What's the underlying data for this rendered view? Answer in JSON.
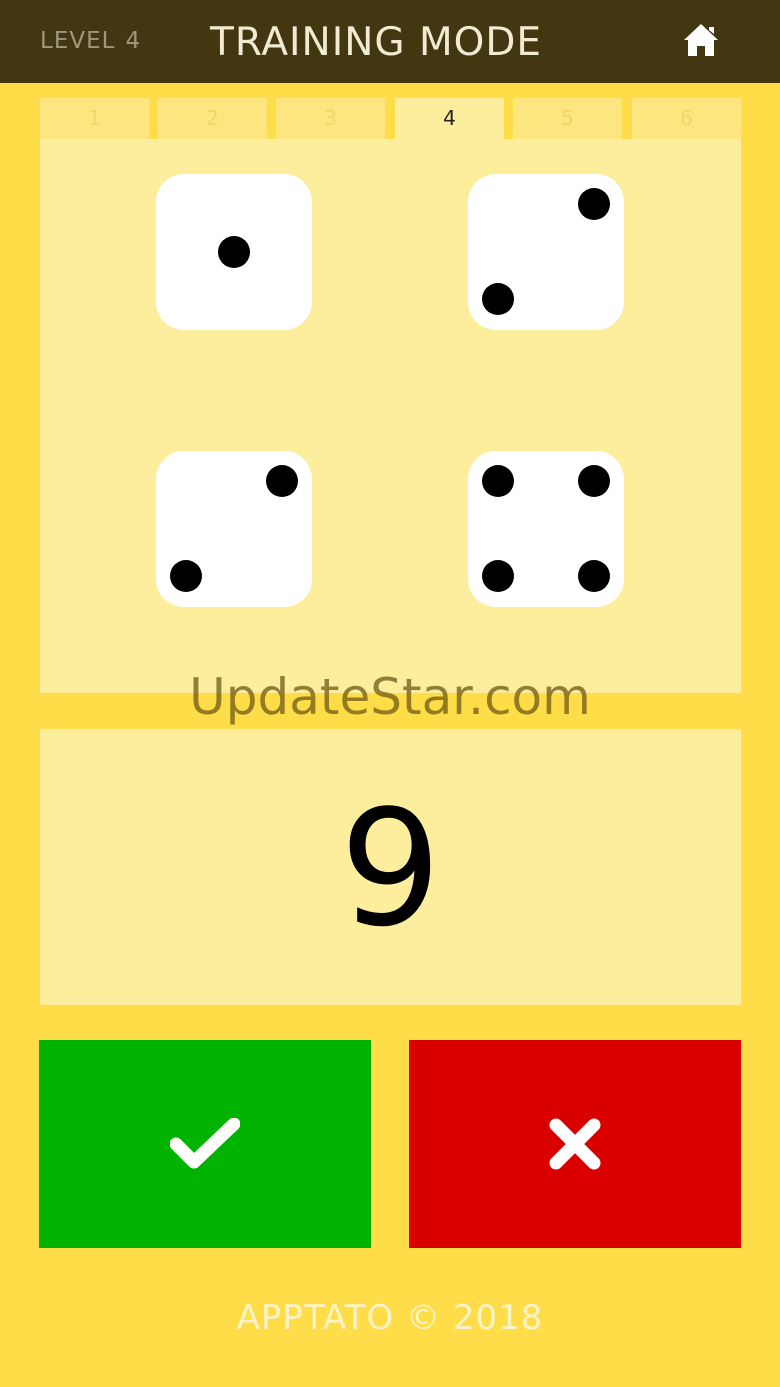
{
  "header": {
    "level_label": "LEVEL",
    "level_value": "4",
    "title": "TRAINING MODE",
    "home_icon": "home-icon"
  },
  "tabs": [
    {
      "label": "1",
      "active": false
    },
    {
      "label": "2",
      "active": false
    },
    {
      "label": "3",
      "active": false
    },
    {
      "label": "4",
      "active": true
    },
    {
      "label": "5",
      "active": false
    },
    {
      "label": "6",
      "active": false
    }
  ],
  "dice": [
    {
      "value": 1
    },
    {
      "value": 2
    },
    {
      "value": 2
    },
    {
      "value": 4
    }
  ],
  "watermark": "UpdateStar.com",
  "answer": "9",
  "buttons": {
    "correct_icon": "check-icon",
    "wrong_icon": "close-icon",
    "correct_color": "#00b300",
    "wrong_color": "#db0000"
  },
  "footer": "APPTATO © 2018",
  "colors": {
    "background": "#fedd48",
    "header": "#433712",
    "panel": "#fdee9e"
  }
}
